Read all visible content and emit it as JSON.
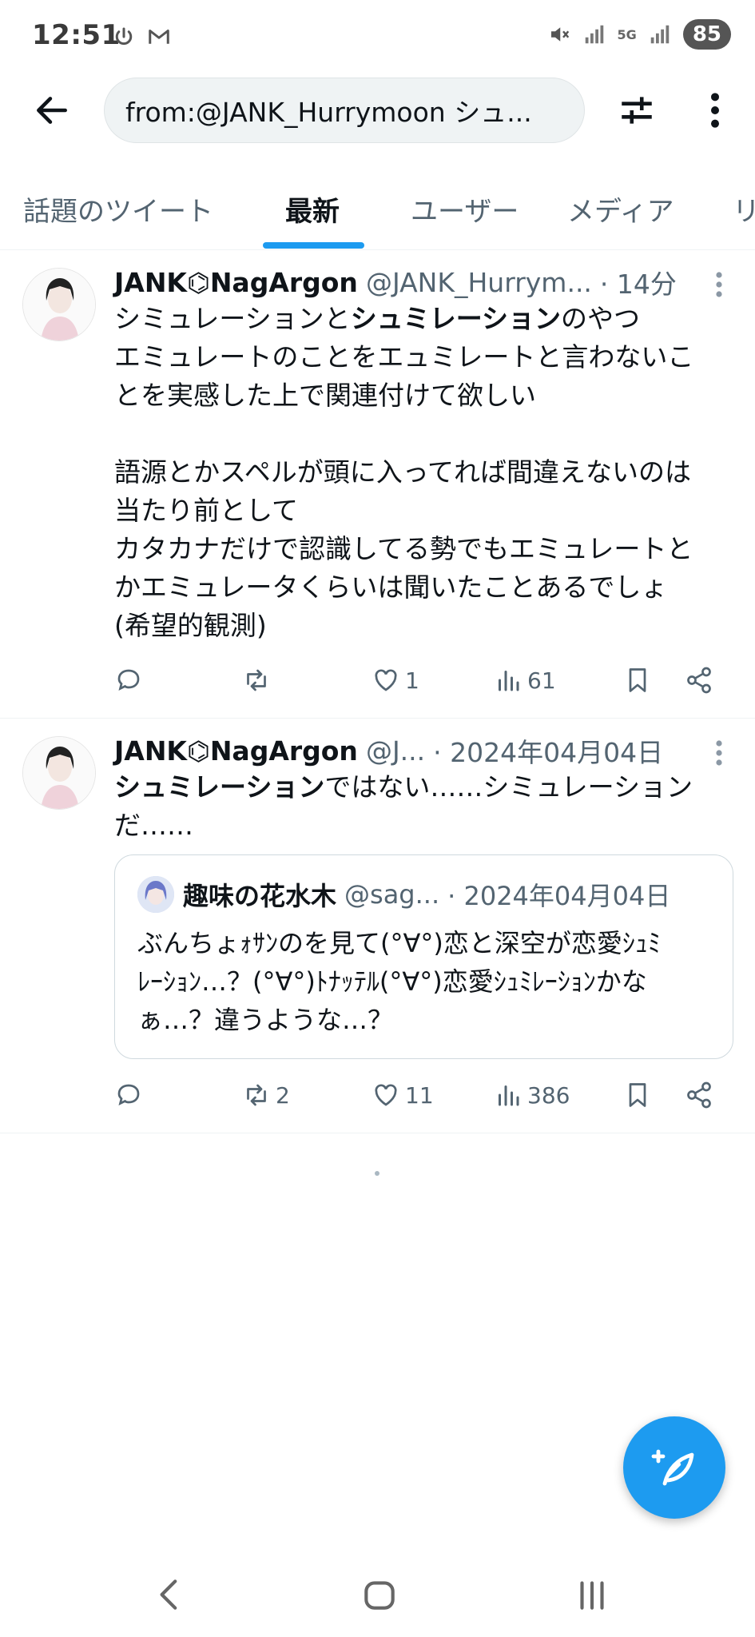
{
  "status_bar": {
    "time": "12:51",
    "battery": "85",
    "network": "5G",
    "icons": [
      "power-icon",
      "gmail-icon",
      "mute-icon",
      "signal-icon",
      "signal-icon"
    ]
  },
  "search": {
    "query": "from:@JANK_Hurrymoon シュ..."
  },
  "tabs": [
    {
      "label": "話題のツイート"
    },
    {
      "label": "最新"
    },
    {
      "label": "ユーザー"
    },
    {
      "label": "メディア"
    },
    {
      "label": "リ"
    }
  ],
  "active_tab": "最新",
  "tweets": [
    {
      "name": "JANK⌬NagArgon",
      "handle": "@JANK_Hurrym...",
      "time": "· 14分",
      "line1_a": "シミュレーションと",
      "line1_b": "シュミレーション",
      "line1_c": "のやつ",
      "line2": "エミュレートのことをエュミレートと言わないこ",
      "line3": "とを実感した上で関連付けて欲しい",
      "line4": "語源とかスペルが頭に入ってれば間違えないのは",
      "line5": "当たり前として",
      "line6": "カタカナだけで認識してる勢でもエミュレートと",
      "line7": "かエミュレータくらいは聞いたことあるでしょ",
      "line8": "(希望的観測)",
      "replies": "",
      "retweets": "",
      "likes": "1",
      "views": "61"
    },
    {
      "name": "JANK⌬NagArgon",
      "handle": "@J...",
      "time": "· 2024年04月04日",
      "line1_a": "シュミレーション",
      "line1_b": "ではない……シミュレーション",
      "line2": "だ……",
      "replies": "",
      "retweets": "2",
      "likes": "11",
      "views": "386",
      "quote": {
        "name": "趣味の花水木",
        "handle": "@sag...",
        "time": "· 2024年04月04日",
        "line1": "ぶんちょｫｻﾝのを見て(°∀°)恋と深空が恋愛ｼｭﾐ",
        "line2": "ﾚｰｼｮﾝ…？(°∀°)ﾄﾅｯﾃﾙ(°∀°)恋愛ｼｭﾐﾚｰｼｮﾝかな",
        "line3": "ぁ…？違うような…？"
      }
    }
  ],
  "colors": {
    "accent": "#1d9bf0",
    "text_primary": "#0f1419",
    "text_secondary": "#536471",
    "border": "#eff3f4"
  }
}
